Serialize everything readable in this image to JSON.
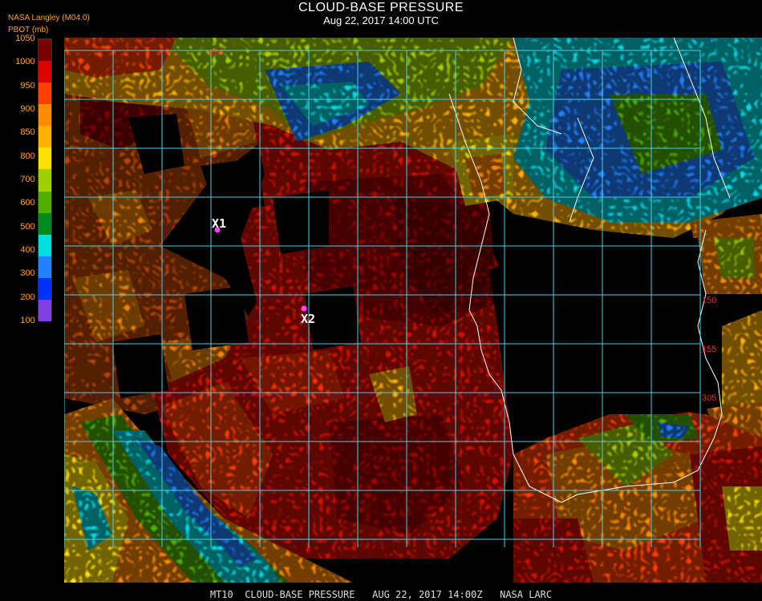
{
  "header": {
    "title": "CLOUD-BASE PRESSURE",
    "subtitle": "Aug 22, 2017 14:00 UTC",
    "source": "NASA Langley (M04.0)",
    "units": "PBOT (mb)"
  },
  "legend": {
    "labels": [
      "1050",
      "1000",
      "950",
      "900",
      "850",
      "800",
      "700",
      "600",
      "500",
      "400",
      "300",
      "200",
      "100"
    ],
    "colors": [
      "#7a0000",
      "#e00000",
      "#ff4000",
      "#ff8c00",
      "#ffb000",
      "#ffe000",
      "#a0d000",
      "#50b000",
      "#008a20",
      "#00e0e0",
      "#2080ff",
      "#0030ff",
      "#8040e0"
    ]
  },
  "map": {
    "markers": [
      {
        "label": "X1",
        "color": "#ff40ff"
      },
      {
        "label": "X2",
        "color": "#ff40ff"
      }
    ],
    "grid_labels": [
      "150",
      "155",
      "305",
      "255"
    ],
    "grid_color": "#4fd0e0",
    "coast_color": "#ffffff"
  },
  "footer": {
    "text": "MT10  CLOUD-BASE PRESSURE   AUG 22, 2017 14:00Z   NASA LARC"
  }
}
